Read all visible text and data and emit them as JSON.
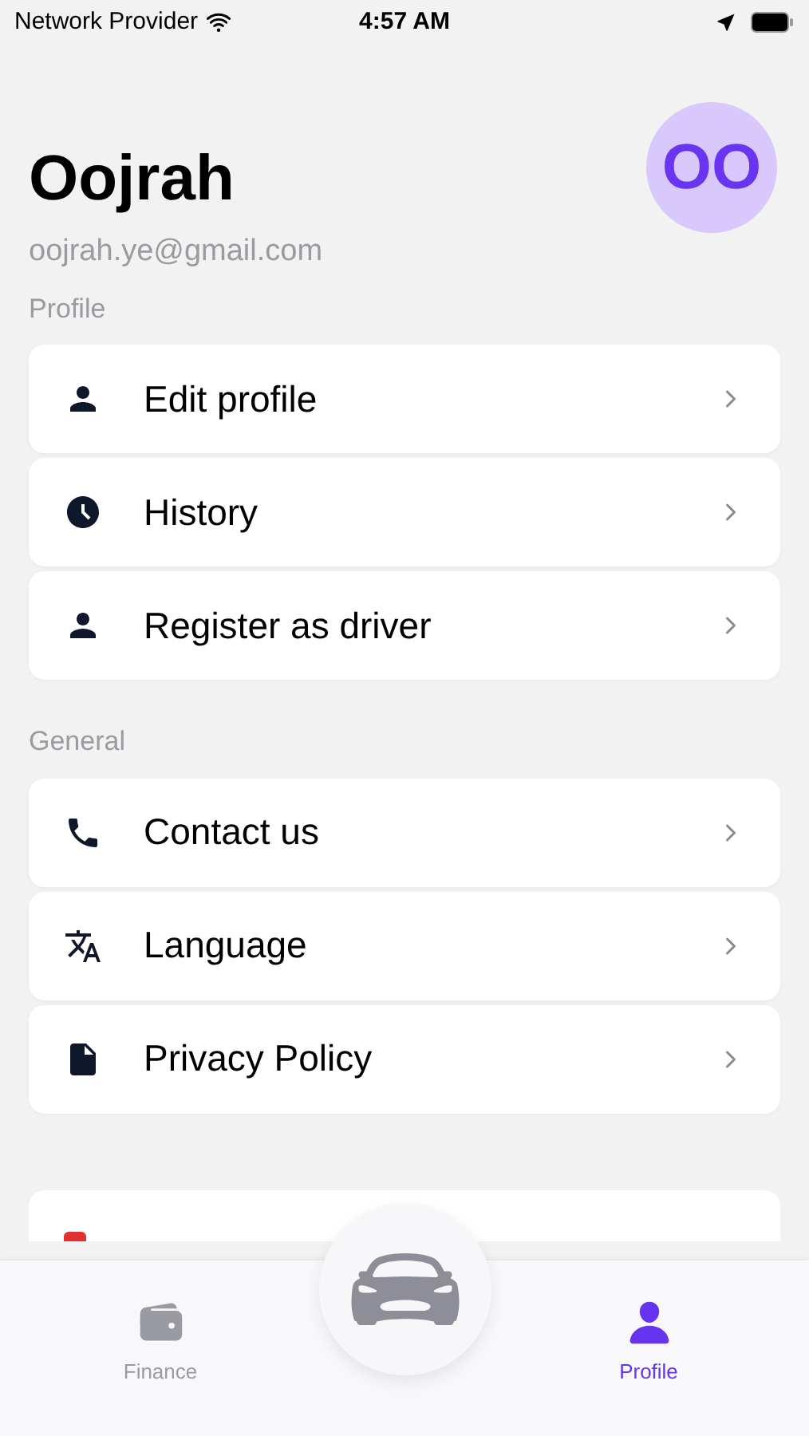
{
  "status_bar": {
    "carrier": "Network Provider",
    "time": "4:57 AM"
  },
  "user": {
    "name": "Oojrah",
    "email": "oojrah.ye@gmail.com",
    "initials": "OO"
  },
  "sections": [
    {
      "title": "Profile",
      "items": [
        {
          "label": "Edit profile"
        },
        {
          "label": "History"
        },
        {
          "label": "Register as driver"
        }
      ]
    },
    {
      "title": "General",
      "items": [
        {
          "label": "Contact us"
        },
        {
          "label": "Language"
        },
        {
          "label": "Privacy Policy"
        }
      ]
    }
  ],
  "tab_bar": [
    {
      "label": "Finance",
      "selected": false
    },
    {
      "label": "Profile",
      "selected": true
    }
  ]
}
